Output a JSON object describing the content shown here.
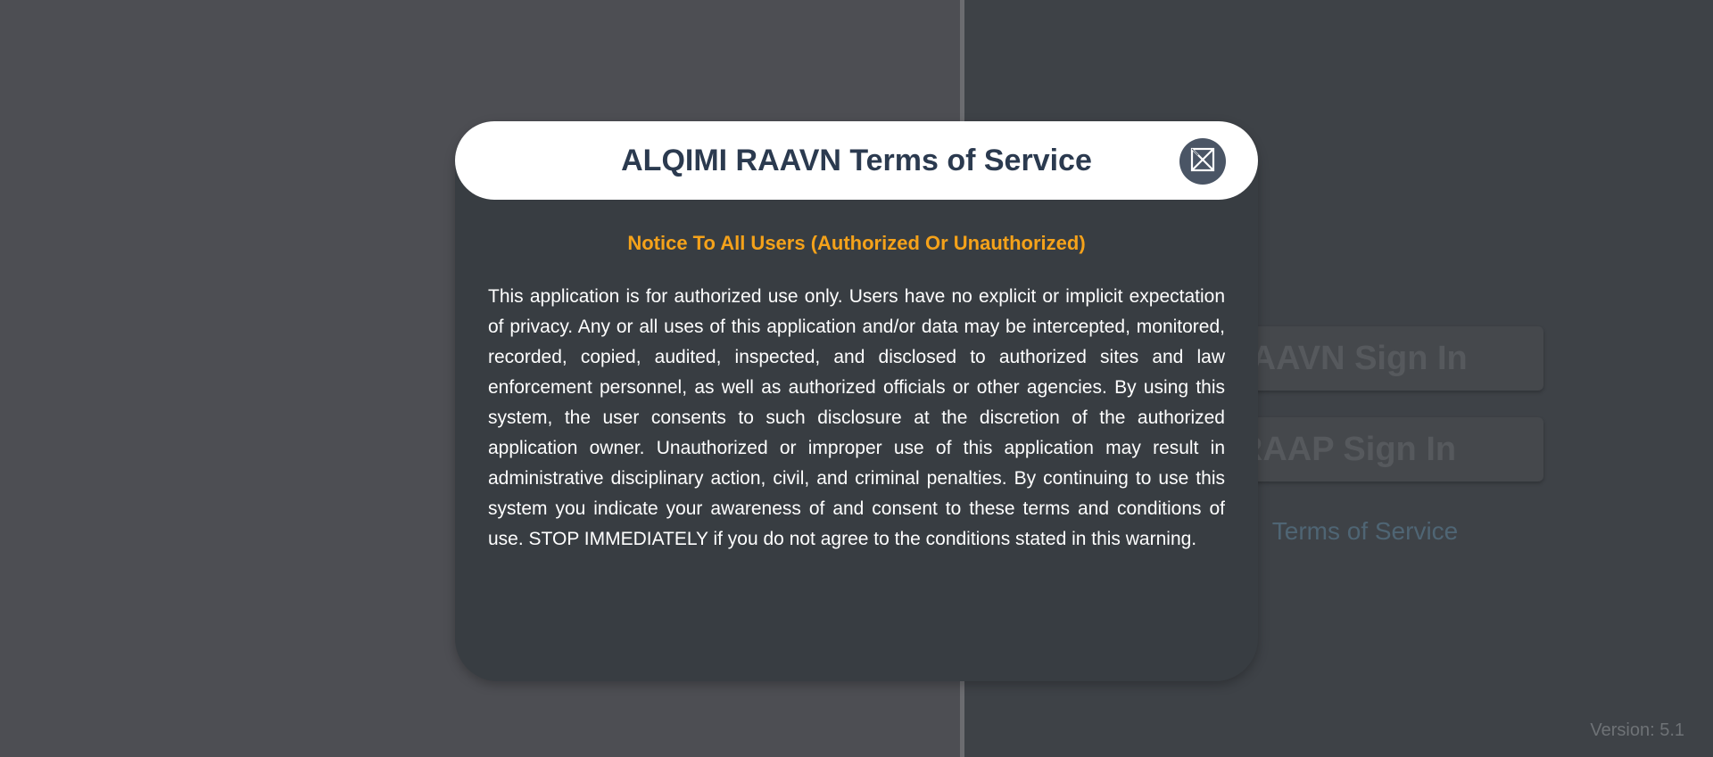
{
  "background": {
    "raavn_sign_in_label": "RAAVN Sign In",
    "raap_sign_in_label": "RAAP Sign In",
    "terms_link_label": "Terms of Service",
    "version_label": "Version: 5.1"
  },
  "modal": {
    "title": "ALQIMI RAAVN Terms of Service",
    "close_icon": "close-icon",
    "notice_heading": "Notice To All Users (Authorized Or Unauthorized)",
    "notice_body": "This application is for authorized use only. Users have no explicit or implicit expectation of privacy. Any or all uses of this application and/or data may be intercepted, monitored, recorded, copied, audited, inspected, and disclosed to authorized sites and law enforcement personnel, as well as authorized officials or other agencies. By using this system, the user consents to such disclosure at the discretion of the authorized application owner. Unauthorized or improper use of this application may result in administrative disciplinary action, civil, and criminal penalties. By continuing to use this system you indicate your awareness of and consent to these terms and conditions of use. STOP IMMEDIATELY if you do not agree to the conditions stated in this warning."
  },
  "colors": {
    "title": "#2b3a4f",
    "notice_heading": "#f5a21a",
    "modal_background": "#383d42",
    "close_button": "#4a5565"
  }
}
